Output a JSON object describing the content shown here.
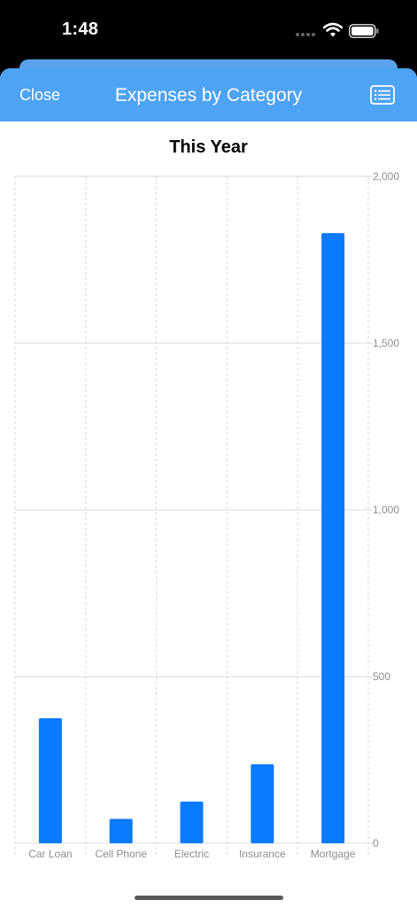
{
  "status": {
    "time": "1:48"
  },
  "nav": {
    "close_label": "Close",
    "title": "Expenses by Category"
  },
  "colors": {
    "accent": "#4da3f5",
    "bar": "#0a7aff"
  },
  "icons": {
    "nav_right": "list-icon"
  },
  "chart_data": {
    "type": "bar",
    "title": "This Year",
    "categories": [
      "Car Loan",
      "Cell Phone",
      "Electric",
      "Insurance",
      "Mortgage"
    ],
    "values": [
      375,
      73,
      125,
      237,
      1830
    ],
    "ylim": [
      0,
      2000
    ],
    "yticks": [
      0,
      500,
      1000,
      1500,
      2000
    ],
    "ytick_labels": [
      "0",
      "500",
      "1,000",
      "1,500",
      "2,000"
    ],
    "y_axis_position": "right",
    "grid": true
  }
}
